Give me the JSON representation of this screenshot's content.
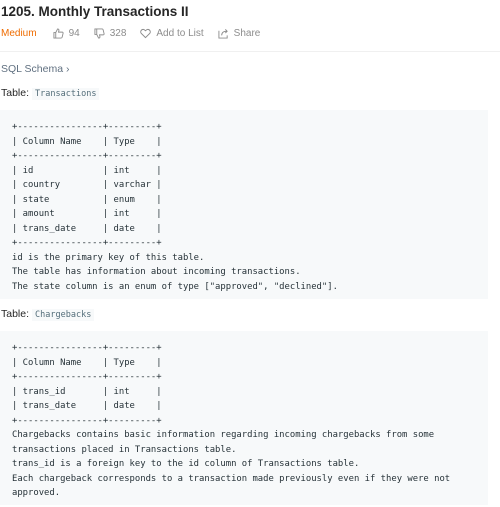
{
  "header": {
    "title": "1205. Monthly Transactions II",
    "difficulty": "Medium",
    "likes": "94",
    "dislikes": "328",
    "add_to_list": "Add to List",
    "share": "Share",
    "difficulty_color": "#ef6c00"
  },
  "schema_link": "SQL Schema ›",
  "tables": [
    {
      "label": "Table:",
      "name": "Transactions",
      "block": "+----------------+---------+\n| Column Name    | Type    |\n+----------------+---------+\n| id             | int     |\n| country        | varchar |\n| state          | enum    |\n| amount         | int     |\n| trans_date     | date    |\n+----------------+---------+\nid is the primary key of this table.\nThe table has information about incoming transactions.\nThe state column is an enum of type [\"approved\", \"declined\"]."
    },
    {
      "label": "Table:",
      "name": "Chargebacks",
      "block": "+----------------+---------+\n| Column Name    | Type    |\n+----------------+---------+\n| trans_id       | int     |\n| trans_date     | date    |\n+----------------+---------+\nChargebacks contains basic information regarding incoming chargebacks from some\ntransactions placed in Transactions table.\ntrans_id is a foreign key to the id column of Transactions table.\nEach chargeback corresponds to a transaction made previously even if they were not\napproved."
    }
  ]
}
